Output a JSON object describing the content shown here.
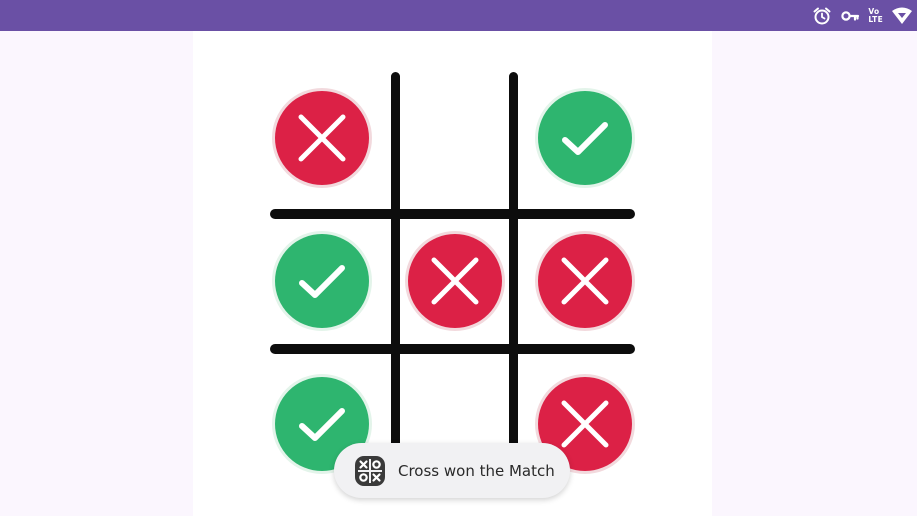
{
  "status_bar": {
    "background_color": "#6a50a5",
    "icons": [
      "alarm-icon",
      "vpn-key-icon",
      "volte-signal-icon",
      "wifi-signal-icon"
    ],
    "volte_label": "Vo",
    "lte_label": "LTE"
  },
  "board": {
    "rows": [
      [
        "cross",
        "empty",
        "check"
      ],
      [
        "check",
        "cross",
        "cross"
      ],
      [
        "check",
        "empty",
        "cross"
      ]
    ],
    "colors": {
      "cross": "#dc2146",
      "check": "#2eb56f",
      "grid": "#0d0d0d"
    }
  },
  "toast": {
    "icon": "tic-tac-toe-app-icon",
    "message": "Cross won the Match"
  }
}
